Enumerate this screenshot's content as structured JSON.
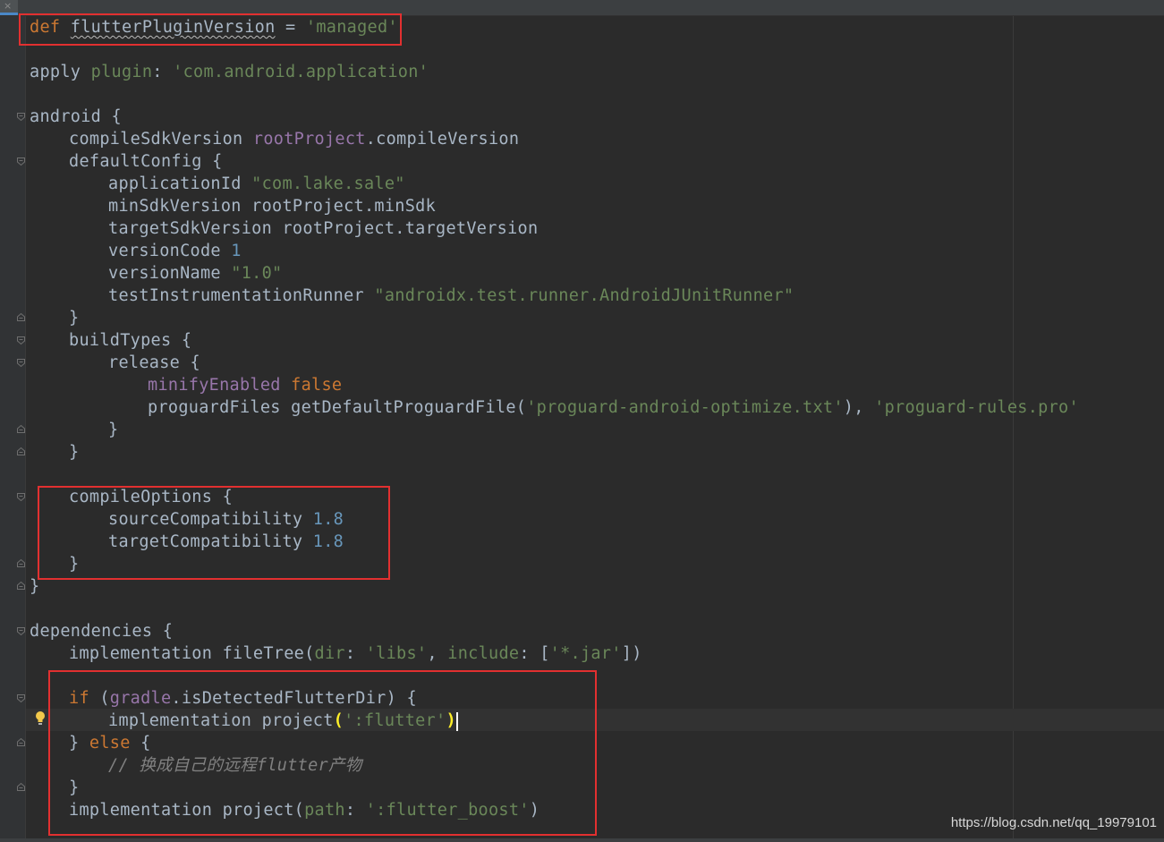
{
  "editor": {
    "tab_close_glyph": "×",
    "lines": {
      "l01": {
        "kw_def": "def",
        "name": "flutterPluginVersion",
        "eq": " = ",
        "val": "'managed'"
      },
      "l03": {
        "apply": "apply ",
        "plugin": "plugin",
        "colon": ": ",
        "val": "'com.android.application'"
      },
      "l05": {
        "text": "android {"
      },
      "l06": {
        "prop": "compileSdkVersion ",
        "root": "rootProject",
        "rest": ".compileVersion"
      },
      "l07": {
        "text": "defaultConfig {"
      },
      "l08": {
        "prop": "applicationId ",
        "val": "\"com.lake.sale\""
      },
      "l09": {
        "text": "minSdkVersion rootProject.minSdk"
      },
      "l10": {
        "text": "targetSdkVersion rootProject.targetVersion"
      },
      "l11": {
        "prop": "versionCode ",
        "val": "1"
      },
      "l12": {
        "prop": "versionName ",
        "val": "\"1.0\""
      },
      "l13": {
        "prop": "testInstrumentationRunner ",
        "val": "\"androidx.test.runner.AndroidJUnitRunner\""
      },
      "l14": {
        "text": "}"
      },
      "l15": {
        "text": "buildTypes {"
      },
      "l16": {
        "text": "release {"
      },
      "l17": {
        "prop": "minifyEnabled",
        "sp": " ",
        "val": "false"
      },
      "l18": {
        "a": "proguardFiles getDefaultProguardFile(",
        "s1": "'proguard-android-optimize.txt'",
        "b": "), ",
        "s2": "'proguard-rules.pro'"
      },
      "l19": {
        "text": "}"
      },
      "l20": {
        "text": "}"
      },
      "l22": {
        "text": "compileOptions {"
      },
      "l23": {
        "prop": "sourceCompatibility ",
        "val": "1.8"
      },
      "l24": {
        "prop": "targetCompatibility ",
        "val": "1.8"
      },
      "l25": {
        "text": "}"
      },
      "l26": {
        "text": "}"
      },
      "l28": {
        "text": "dependencies {"
      },
      "l29": {
        "a": "implementation fileTree(",
        "dir": "dir",
        "c1": ": ",
        "s1": "'libs'",
        "comma": ", ",
        "inc": "include",
        "c2": ": [",
        "s2": "'*.jar'",
        "end": "])"
      },
      "l31": {
        "kw_if": "if",
        "a": " (",
        "gradle": "gradle",
        "b": ".isDetectedFlutterDir) {"
      },
      "l32": {
        "a": "implementation project",
        "p1": "(",
        "s": "':flutter'",
        "p2": ")"
      },
      "l33": {
        "a": "} ",
        "kw_else": "else",
        "b": " {"
      },
      "l34": {
        "cmt": "// 换成自己的远程flutter产物"
      },
      "l35": {
        "text": "}"
      },
      "l36": {
        "a": "implementation project(",
        "path": "path",
        "c": ": ",
        "s": "':flutter_boost'",
        "end": ")"
      }
    }
  },
  "watermark": "https://blog.csdn.net/qq_19979101"
}
